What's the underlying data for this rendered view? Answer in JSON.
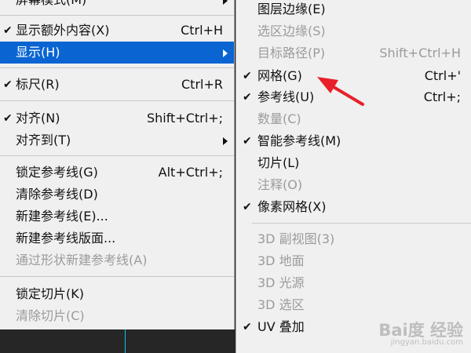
{
  "left_menu": {
    "items": [
      {
        "label": "屏幕模式(M)",
        "shortcut": "",
        "checked": false,
        "disabled": false,
        "submenu": true,
        "highlighted": false
      },
      {
        "label": "显示额外内容(X)",
        "shortcut": "Ctrl+H",
        "checked": true,
        "disabled": false,
        "submenu": false,
        "highlighted": false
      },
      {
        "label": "显示(H)",
        "shortcut": "",
        "checked": false,
        "disabled": false,
        "submenu": true,
        "highlighted": true
      },
      {
        "label": "标尺(R)",
        "shortcut": "Ctrl+R",
        "checked": true,
        "disabled": false,
        "submenu": false,
        "highlighted": false
      },
      {
        "label": "对齐(N)",
        "shortcut": "Shift+Ctrl+;",
        "checked": true,
        "disabled": false,
        "submenu": false,
        "highlighted": false
      },
      {
        "label": "对齐到(T)",
        "shortcut": "",
        "checked": false,
        "disabled": false,
        "submenu": true,
        "highlighted": false
      },
      {
        "label": "锁定参考线(G)",
        "shortcut": "Alt+Ctrl+;",
        "checked": false,
        "disabled": false,
        "submenu": false,
        "highlighted": false
      },
      {
        "label": "清除参考线(D)",
        "shortcut": "",
        "checked": false,
        "disabled": false,
        "submenu": false,
        "highlighted": false
      },
      {
        "label": "新建参考线(E)...",
        "shortcut": "",
        "checked": false,
        "disabled": false,
        "submenu": false,
        "highlighted": false
      },
      {
        "label": "新建参考线版面...",
        "shortcut": "",
        "checked": false,
        "disabled": false,
        "submenu": false,
        "highlighted": false
      },
      {
        "label": "通过形状新建参考线(A)",
        "shortcut": "",
        "checked": false,
        "disabled": true,
        "submenu": false,
        "highlighted": false
      },
      {
        "label": "锁定切片(K)",
        "shortcut": "",
        "checked": false,
        "disabled": false,
        "submenu": false,
        "highlighted": false
      },
      {
        "label": "清除切片(C)",
        "shortcut": "",
        "checked": false,
        "disabled": true,
        "submenu": false,
        "highlighted": false
      }
    ]
  },
  "right_menu": {
    "items": [
      {
        "label": "图层边缘(E)",
        "shortcut": "",
        "checked": false,
        "disabled": false
      },
      {
        "label": "选区边缘(S)",
        "shortcut": "",
        "checked": false,
        "disabled": true
      },
      {
        "label": "目标路径(P)",
        "shortcut": "Shift+Ctrl+H",
        "checked": false,
        "disabled": true
      },
      {
        "label": "网格(G)",
        "shortcut": "Ctrl+'",
        "checked": true,
        "disabled": false
      },
      {
        "label": "参考线(U)",
        "shortcut": "Ctrl+;",
        "checked": true,
        "disabled": false
      },
      {
        "label": "数量(C)",
        "shortcut": "",
        "checked": false,
        "disabled": true
      },
      {
        "label": "智能参考线(M)",
        "shortcut": "",
        "checked": true,
        "disabled": false
      },
      {
        "label": "切片(L)",
        "shortcut": "",
        "checked": false,
        "disabled": false
      },
      {
        "label": "注释(O)",
        "shortcut": "",
        "checked": false,
        "disabled": true
      },
      {
        "label": "像素网格(X)",
        "shortcut": "",
        "checked": true,
        "disabled": false
      },
      {
        "label": "3D 副视图(3)",
        "shortcut": "",
        "checked": false,
        "disabled": true
      },
      {
        "label": "3D 地面",
        "shortcut": "",
        "checked": false,
        "disabled": true
      },
      {
        "label": "3D 光源",
        "shortcut": "",
        "checked": false,
        "disabled": true
      },
      {
        "label": "3D 选区",
        "shortcut": "",
        "checked": false,
        "disabled": true
      },
      {
        "label": "UV 叠加",
        "shortcut": "",
        "checked": true,
        "disabled": false
      }
    ]
  },
  "icons": {
    "check": "checkmark-icon",
    "submenu": "submenu-arrow-icon",
    "annotation": "red-arrow-annotation"
  },
  "colors": {
    "menu_bg": "#f0f0f0",
    "highlight": "#0a64d2",
    "disabled_text": "#9b9b9b",
    "annotation": "#e8202a",
    "guide": "#00c8e8"
  },
  "watermark": {
    "main": "Bai度 经验",
    "sub": "jingyan.baidu.com"
  }
}
